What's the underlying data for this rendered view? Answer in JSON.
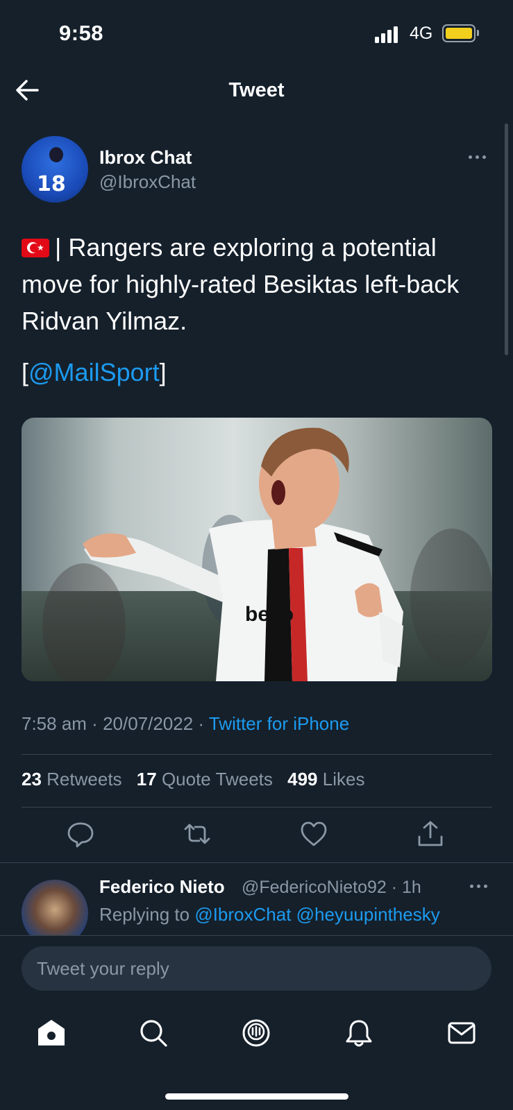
{
  "status_bar": {
    "time": "9:58",
    "network": "4G",
    "battery_color": "#f2cf1d"
  },
  "header": {
    "back_icon": "arrow-left-icon",
    "title": "Tweet"
  },
  "tweet": {
    "author_name": "Ibrox Chat",
    "author_handle": "@IbroxChat",
    "text_before_mention": "| Rangers are exploring a potential move for highly-rated Besiktas left-back Ridvan Yilmaz.",
    "mention_open": "[",
    "mention": "@MailSport",
    "mention_close": "]",
    "time": "7:58 am",
    "date": "20/07/2022",
    "source": "Twitter for iPhone",
    "separator": " · ",
    "retweets_count": "23",
    "retweets_label": "Retweets",
    "quotes_count": "17",
    "quotes_label": "Quote Tweets",
    "likes_count": "499",
    "likes_label": "Likes"
  },
  "reply": {
    "author_name": "Federico Nieto",
    "handle_time": "@FedericoNieto92 · 1h",
    "replying_to_label": "Replying to",
    "replying_to_users": "@IbroxChat @heyuupinthesky"
  },
  "composer": {
    "placeholder": "Tweet your reply"
  },
  "tabbar": {
    "items": [
      "home-icon",
      "search-icon",
      "spaces-icon",
      "notifications-icon",
      "messages-icon"
    ]
  },
  "colors": {
    "background": "#15202b",
    "accent": "#1d9bf0",
    "secondary_text": "#8b98a5"
  }
}
